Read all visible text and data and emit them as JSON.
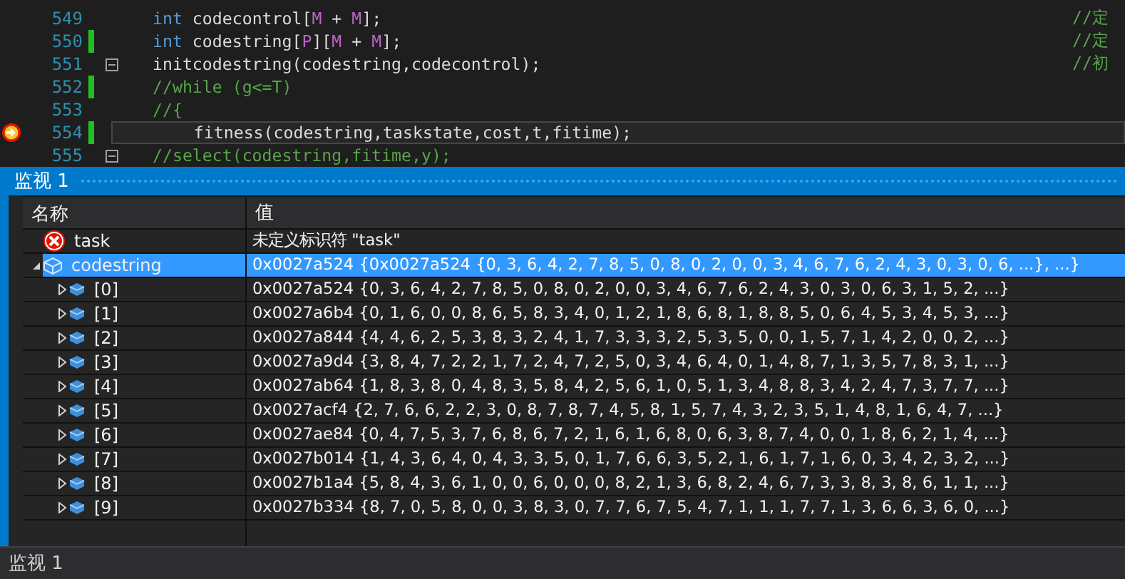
{
  "editor": {
    "lines": [
      {
        "number": "549",
        "changed": false,
        "foldable": false,
        "current": false,
        "tokens": [
          {
            "text": "int",
            "kind": "keyword"
          },
          {
            "text": " codecontrol[",
            "kind": "plain"
          },
          {
            "text": "M",
            "kind": "macro"
          },
          {
            "text": " + ",
            "kind": "plain"
          },
          {
            "text": "M",
            "kind": "macro"
          },
          {
            "text": "];",
            "kind": "plain"
          }
        ],
        "comment": "//定"
      },
      {
        "number": "550",
        "changed": true,
        "foldable": false,
        "current": false,
        "tokens": [
          {
            "text": "int",
            "kind": "keyword"
          },
          {
            "text": " codestring[",
            "kind": "plain"
          },
          {
            "text": "P",
            "kind": "macro"
          },
          {
            "text": "][",
            "kind": "plain"
          },
          {
            "text": "M",
            "kind": "macro"
          },
          {
            "text": " + ",
            "kind": "plain"
          },
          {
            "text": "M",
            "kind": "macro"
          },
          {
            "text": "];",
            "kind": "plain"
          }
        ],
        "comment": "//定"
      },
      {
        "number": "551",
        "changed": false,
        "foldable": true,
        "current": false,
        "tokens": [
          {
            "text": "initcodestring(codestring,codecontrol);",
            "kind": "plain"
          }
        ],
        "comment": "//初"
      },
      {
        "number": "552",
        "changed": true,
        "foldable": false,
        "current": false,
        "tokens": [
          {
            "text": "//while (g<=T)",
            "kind": "comment"
          }
        ]
      },
      {
        "number": "553",
        "changed": false,
        "foldable": false,
        "current": false,
        "tokens": [
          {
            "text": "//{",
            "kind": "comment"
          }
        ]
      },
      {
        "number": "554",
        "changed": true,
        "foldable": false,
        "current": true,
        "tokens": [
          {
            "text": "    fitness(codestring,taskstate,cost,t,fitime);",
            "kind": "plain"
          }
        ]
      },
      {
        "number": "555",
        "changed": false,
        "foldable": true,
        "current": false,
        "tokens": [
          {
            "text": "//select(codestring,fitime,y);",
            "kind": "comment"
          }
        ]
      }
    ]
  },
  "watch": {
    "title": "监视 1",
    "columns": [
      "名称",
      "值"
    ],
    "items": [
      {
        "kind": "error",
        "name": "task",
        "value": "未定义标识符 \"task\"",
        "selected": false
      },
      {
        "kind": "object",
        "name": "codestring",
        "value": "0x0027a524 {0x0027a524 {0, 3, 6, 4, 2, 7, 8, 5, 0, 8, 0, 2, 0, 0, 3, 4, 6, 7, 6, 2, 4, 3, 0, 3, 0, 6, ...}, ...}",
        "selected": true,
        "expanded": true,
        "children": [
          {
            "kind": "field",
            "name": "[0]",
            "value": "0x0027a524 {0, 3, 6, 4, 2, 7, 8, 5, 0, 8, 0, 2, 0, 0, 3, 4, 6, 7, 6, 2, 4, 3, 0, 3, 0, 6, 3, 1, 5, 2, ...}",
            "selected": false,
            "expanded": false
          },
          {
            "kind": "field",
            "name": "[1]",
            "value": "0x0027a6b4 {0, 1, 6, 0, 0, 8, 6, 5, 8, 3, 4, 0, 1, 2, 1, 8, 6, 8, 1, 8, 8, 5, 0, 6, 4, 5, 3, 4, 5, 3, ...}",
            "selected": false,
            "expanded": false
          },
          {
            "kind": "field",
            "name": "[2]",
            "value": "0x0027a844 {4, 4, 6, 2, 5, 3, 8, 3, 2, 4, 1, 7, 3, 3, 3, 2, 5, 3, 5, 0, 0, 1, 5, 7, 1, 4, 2, 0, 0, 2, ...}",
            "selected": false,
            "expanded": false
          },
          {
            "kind": "field",
            "name": "[3]",
            "value": "0x0027a9d4 {3, 8, 4, 7, 2, 2, 1, 7, 2, 4, 7, 2, 5, 0, 3, 4, 6, 4, 0, 1, 4, 8, 7, 1, 3, 5, 7, 8, 3, 1, ...}",
            "selected": false,
            "expanded": false
          },
          {
            "kind": "field",
            "name": "[4]",
            "value": "0x0027ab64 {1, 8, 3, 8, 0, 4, 8, 3, 5, 8, 4, 2, 5, 6, 1, 0, 5, 1, 3, 4, 8, 8, 3, 4, 2, 4, 7, 3, 7, 7, ...}",
            "selected": false,
            "expanded": false
          },
          {
            "kind": "field",
            "name": "[5]",
            "value": "0x0027acf4 {2, 7, 6, 6, 2, 2, 3, 0, 8, 7, 8, 7, 4, 5, 8, 1, 5, 7, 4, 3, 2, 3, 5, 1, 4, 8, 1, 6, 4, 7, ...}",
            "selected": false,
            "expanded": false
          },
          {
            "kind": "field",
            "name": "[6]",
            "value": "0x0027ae84 {0, 4, 7, 5, 3, 7, 6, 8, 6, 7, 2, 1, 6, 1, 6, 8, 0, 6, 3, 8, 7, 4, 0, 0, 1, 8, 6, 2, 1, 4, ...}",
            "selected": false,
            "expanded": false
          },
          {
            "kind": "field",
            "name": "[7]",
            "value": "0x0027b014 {1, 4, 3, 6, 4, 0, 4, 3, 3, 5, 0, 1, 7, 6, 6, 3, 5, 2, 1, 6, 1, 7, 1, 6, 0, 3, 4, 2, 3, 2, ...}",
            "selected": false,
            "expanded": false
          },
          {
            "kind": "field",
            "name": "[8]",
            "value": "0x0027b1a4 {5, 8, 4, 3, 6, 1, 0, 0, 6, 0, 0, 0, 8, 2, 1, 3, 6, 8, 2, 4, 6, 7, 3, 3, 8, 3, 8, 6, 1, 1, ...}",
            "selected": false,
            "expanded": false
          },
          {
            "kind": "field",
            "name": "[9]",
            "value": "0x0027b334 {8, 7, 0, 5, 8, 0, 0, 3, 8, 3, 0, 7, 7, 6, 7, 5, 4, 7, 1, 1, 1, 7, 7, 1, 3, 6, 6, 3, 6, 0, ...}",
            "selected": false,
            "expanded": false
          }
        ]
      }
    ]
  },
  "bottom_tabs": [
    {
      "label": "监视 1",
      "selected": true
    }
  ]
}
